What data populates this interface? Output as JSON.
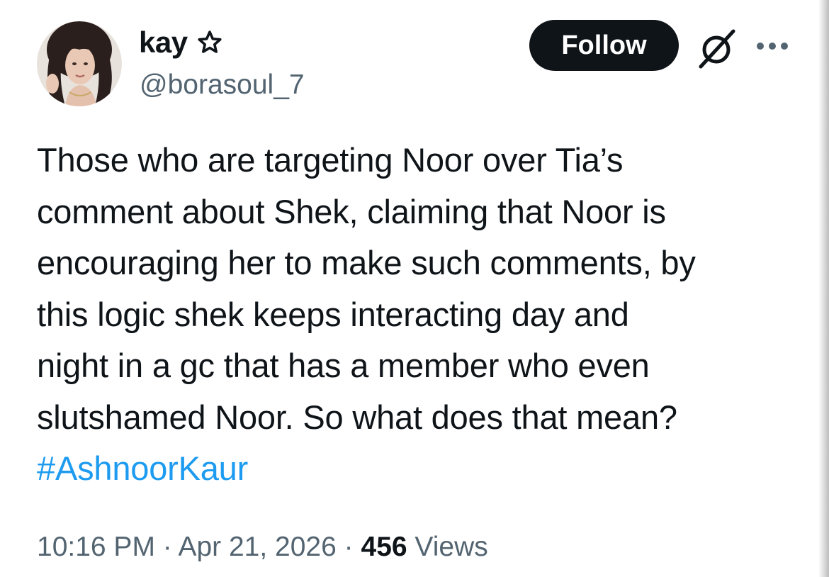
{
  "author": {
    "display_name": "kay",
    "badge_icon": "star-outline-icon",
    "handle": "@borasoul_7",
    "avatar_icon": "profile-photo"
  },
  "actions": {
    "follow_label": "Follow",
    "grok_icon": "grok-slash-circle-icon",
    "more_icon": "more-horizontal-icon"
  },
  "tweet": {
    "lines": [
      "Those who are targeting Noor over Tia’s",
      "comment about Shek, claiming that Noor is",
      "encouraging her to make such comments, by",
      "this logic shek keeps interacting day and",
      "night in a gc that has a member who even",
      "slutshamed Noor. So what does that mean?"
    ],
    "hashtag": "#AshnoorKaur"
  },
  "meta": {
    "time": "10:16 PM",
    "separator": "·",
    "date": "Apr 21, 2026",
    "views_count": "456",
    "views_label": "Views"
  },
  "colors": {
    "text": "#0f1419",
    "secondary": "#536471",
    "link": "#1d9bf0",
    "button_bg": "#0f1419"
  }
}
